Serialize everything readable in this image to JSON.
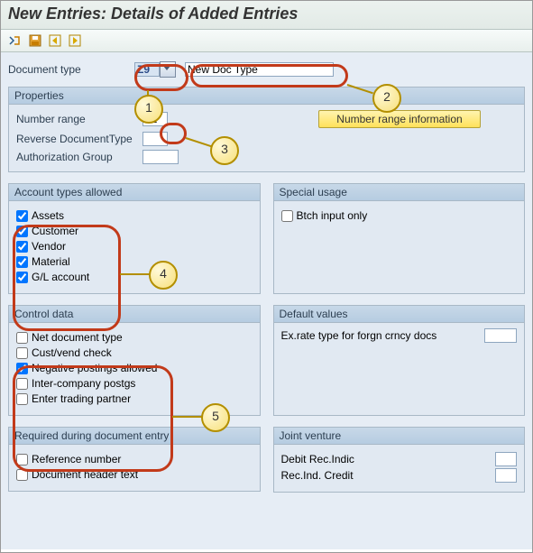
{
  "window_title": "New Entries: Details of Added Entries",
  "toolbar": {
    "icons": [
      "other-object",
      "save",
      "back",
      "exit"
    ]
  },
  "header": {
    "doctype_label": "Document type",
    "doctype_value": "Z9",
    "doctype_desc": "New Doc Type"
  },
  "properties": {
    "title": "Properties",
    "number_range_label": "Number range",
    "number_range_value": "01",
    "reverse_label": "Reverse DocumentType",
    "reverse_value": "",
    "auth_label": "Authorization Group",
    "auth_value": "",
    "nr_info_btn": "Number range information"
  },
  "account_types": {
    "title": "Account types allowed",
    "items": [
      {
        "label": "Assets",
        "checked": true
      },
      {
        "label": "Customer",
        "checked": true
      },
      {
        "label": "Vendor",
        "checked": true
      },
      {
        "label": "Material",
        "checked": true
      },
      {
        "label": "G/L account",
        "checked": true
      }
    ]
  },
  "special_usage": {
    "title": "Special usage",
    "items": [
      {
        "label": "Btch input only",
        "checked": false
      }
    ]
  },
  "control_data": {
    "title": "Control data",
    "items": [
      {
        "label": "Net document type",
        "checked": false
      },
      {
        "label": "Cust/vend check",
        "checked": false
      },
      {
        "label": "Negative postings allowed",
        "checked": true
      },
      {
        "label": "Inter-company postgs",
        "checked": false
      },
      {
        "label": "Enter trading partner",
        "checked": false
      }
    ]
  },
  "default_values": {
    "title": "Default values",
    "exrate_label": "Ex.rate type for forgn crncy docs",
    "exrate_value": ""
  },
  "required": {
    "title": "Required during document entry",
    "items": [
      {
        "label": "Reference number",
        "checked": false
      },
      {
        "label": "Document header text",
        "checked": false
      }
    ]
  },
  "joint_venture": {
    "title": "Joint venture",
    "debit_label": "Debit Rec.Indic",
    "debit_value": "",
    "credit_label": "Rec.Ind. Credit",
    "credit_value": ""
  },
  "annotations": {
    "1": "1",
    "2": "2",
    "3": "3",
    "4": "4",
    "5": "5"
  }
}
